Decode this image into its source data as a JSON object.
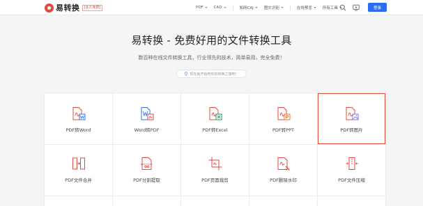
{
  "header": {
    "logo_text": "易转换",
    "logo_badge": "[永久免费]",
    "nav": [
      {
        "label": "PDF",
        "caret": true
      },
      {
        "label": "CAD",
        "caret": true
      },
      {
        "label": "知网CAJ",
        "caret": true
      },
      {
        "label": "图文识别",
        "caret": true
      },
      {
        "label": "在线预览",
        "caret": true
      },
      {
        "label": "所有工具",
        "caret": true
      }
    ],
    "login_label": "登录"
  },
  "hero": {
    "title": "易转换 - 免费好用的文件转换工具",
    "subtitle": "数百种在线文件转换工具，行业领先的技术，简单易用，完全免费！",
    "hint": "现在就开始吧你的转换之旅吧！"
  },
  "tools": {
    "row1": [
      {
        "label": "PDF转Word",
        "icon": "pdf-to-word-icon",
        "accent": "#2c6ef2"
      },
      {
        "label": "Word转PDF",
        "icon": "word-to-pdf-icon",
        "accent": "#2c6ef2"
      },
      {
        "label": "PDF转Excel",
        "icon": "pdf-to-excel-icon",
        "accent": "#1f9a53"
      },
      {
        "label": "PDF转PPT",
        "icon": "pdf-to-ppt-icon",
        "accent": "#e8742c"
      },
      {
        "label": "PDF转图片",
        "icon": "pdf-to-image-icon",
        "accent": "#8a6ee6",
        "selected": true
      }
    ],
    "row2": [
      {
        "label": "PDF文件合并",
        "icon": "merge-icon"
      },
      {
        "label": "PDF分割提取",
        "icon": "split-icon"
      },
      {
        "label": "PDF页面裁剪",
        "icon": "crop-icon"
      },
      {
        "label": "PDF删除水印",
        "icon": "remove-watermark-icon"
      },
      {
        "label": "PDF文件压缩",
        "icon": "compress-icon"
      }
    ]
  },
  "colors": {
    "brand": "#e24a3b",
    "primary": "#2c6ef2"
  }
}
